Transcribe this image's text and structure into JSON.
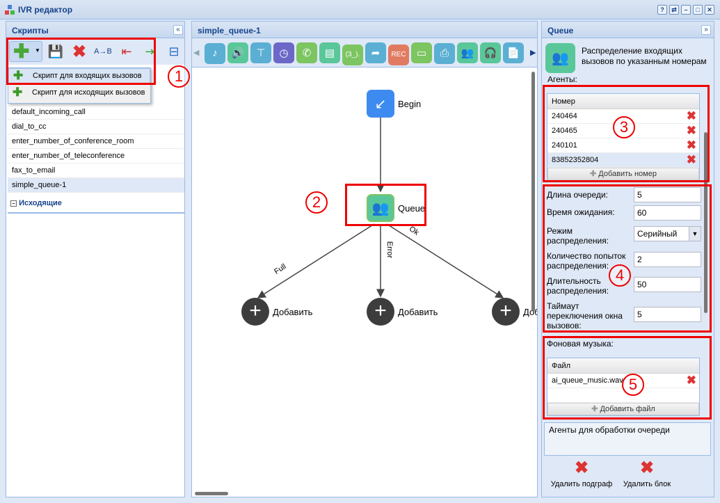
{
  "window": {
    "title": "IVR редактор",
    "buttons": [
      "?",
      "⇄",
      "–",
      "□",
      "✕"
    ]
  },
  "left": {
    "title": "Скрипты",
    "collapse": "«",
    "menu": [
      "Скрипт для входящих вызовов",
      "Скрипт для исходящих вызовов"
    ],
    "scripts": [
      "default_incoming_call",
      "dial_to_cc",
      "enter_number_of_conference_room",
      "enter_number_of_teleconference",
      "fax_to_email",
      "simple_queue-1"
    ],
    "selected": "simple_queue-1",
    "group_outgoing": "Исходящие"
  },
  "center": {
    "title": "simple_queue-1",
    "tools": [
      {
        "icon": "music-icon",
        "color": "#5aafd3",
        "g": "♪"
      },
      {
        "icon": "speaker-icon",
        "color": "#5ac79a",
        "g": "🔊"
      },
      {
        "icon": "hierarchy-icon",
        "color": "#5aafd3",
        "g": "⊤"
      },
      {
        "icon": "clock-icon",
        "color": "#6b68c8",
        "g": "◷"
      },
      {
        "icon": "phone-icon",
        "color": "#7cc561",
        "g": "✆"
      },
      {
        "icon": "form-icon",
        "color": "#5ac79a",
        "g": "▤"
      },
      {
        "icon": "digits-icon",
        "color": "#7cc561",
        "g": "(3_)."
      },
      {
        "icon": "forward-icon",
        "color": "#5aafd3",
        "g": "➦"
      },
      {
        "icon": "record-icon",
        "color": "#e07b62",
        "g": "REC"
      },
      {
        "icon": "card-icon",
        "color": "#7cc561",
        "g": "▭"
      },
      {
        "icon": "fax-icon",
        "color": "#5aafd3",
        "g": "⎙"
      },
      {
        "icon": "queue-icon",
        "color": "#5ac79a",
        "g": "👥"
      },
      {
        "icon": "headset-icon",
        "color": "#5ac79a",
        "g": "🎧"
      },
      {
        "icon": "document-code-icon",
        "color": "#5aafd3",
        "g": "📄"
      }
    ],
    "nodes": {
      "begin": "Begin",
      "queue": "Queue",
      "add": "Добавить"
    },
    "edges": [
      "Full",
      "Error",
      "Ok"
    ]
  },
  "right": {
    "title": "Queue",
    "collapse": "»",
    "description": "Распределение входящих вызовов по указанным номерам",
    "agents_label": "Агенты:",
    "numbers_header": "Номер",
    "numbers": [
      "240464",
      "240465",
      "240101",
      "83852352804"
    ],
    "add_number": "Добавить номер",
    "fields": {
      "queue_length_label": "Длина очереди:",
      "queue_length": "5",
      "wait_label": "Время ожидания:",
      "wait": "60",
      "mode_label": "Режим распределения:",
      "mode": "Серийный",
      "attempts_label": "Количество попыток распределения:",
      "attempts": "2",
      "duration_label": "Длительность распределения:",
      "duration": "50",
      "timeout_label": "Таймаут переключения окна вызовов:",
      "timeout": "5"
    },
    "music_label": "Фоновая музыка:",
    "file_header": "Файл",
    "files": [
      "ai_queue_music.wav"
    ],
    "add_file": "Добавить файл",
    "tooltip": "Агенты для обработки очереди",
    "delete_subgraph": "Удалить подграф",
    "delete_block": "Удалить блок"
  },
  "annotations": [
    "1",
    "2",
    "3",
    "4",
    "5"
  ],
  "colors": {
    "accent": "#15428b",
    "annotation": "#ee0000",
    "queue": "#5ac79a",
    "begin": "#3d8bf0"
  }
}
